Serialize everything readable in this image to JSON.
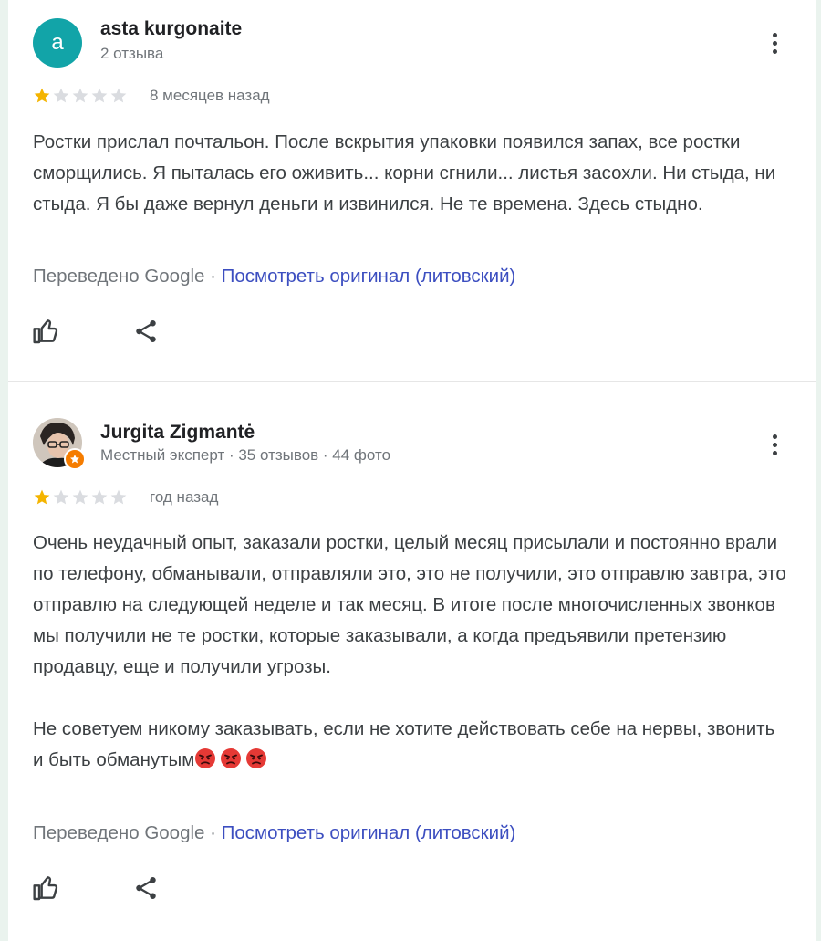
{
  "reviews": [
    {
      "author": "asta kurgonaite",
      "avatar_letter": "a",
      "meta": "2 отзыва",
      "rating": 1,
      "max_rating": 5,
      "time": "8 месяцев назад",
      "text": [
        "Ростки прислал почтальон. После вскрытия упаковки появился запах, все ростки сморщились. Я пыталась его оживить... корни сгнили... листья засохли. Ни стыда, ни стыда. Я бы даже вернул деньги и извинился. Не те времена. Здесь стыдно."
      ],
      "translated_by": "Переведено Google ·",
      "original_link": "Посмотреть оригинал (литовский)"
    },
    {
      "author": "Jurgita Zigmantė",
      "meta": "Местный эксперт · 35 отзывов · 44 фото",
      "rating": 1,
      "max_rating": 5,
      "time": "год назад",
      "text": [
        "Очень неудачный опыт, заказали ростки, целый месяц присылали и постоянно врали по телефону, обманывали, отправляли это, это не получили, это отправлю завтра, это отправлю на следующей неделе и так месяц. В итоге после многочисленных звонков мы получили не те ростки, которые заказывали, а когда предъявили претензию продавцу, еще и получили угрозы.",
        "Не советуем никому заказывать, если не хотите действовать себе на нервы, звонить и быть обманутым"
      ],
      "emoji": [
        "angry-face-icon",
        "angry-face-icon",
        "angry-face-icon"
      ],
      "translated_by": "Переведено Google ·",
      "original_link": "Посмотреть оригинал (литовский)"
    }
  ],
  "colors": {
    "star_filled": "#f4b400",
    "star_empty": "#dadce0",
    "link": "#3c4ec0",
    "avatar_bg": "#12a4a8",
    "local_guide_badge": "#f57c00"
  },
  "icons": [
    "more-vert-icon",
    "thumb-up-icon",
    "share-icon",
    "star-icon",
    "local-guide-badge-icon"
  ]
}
